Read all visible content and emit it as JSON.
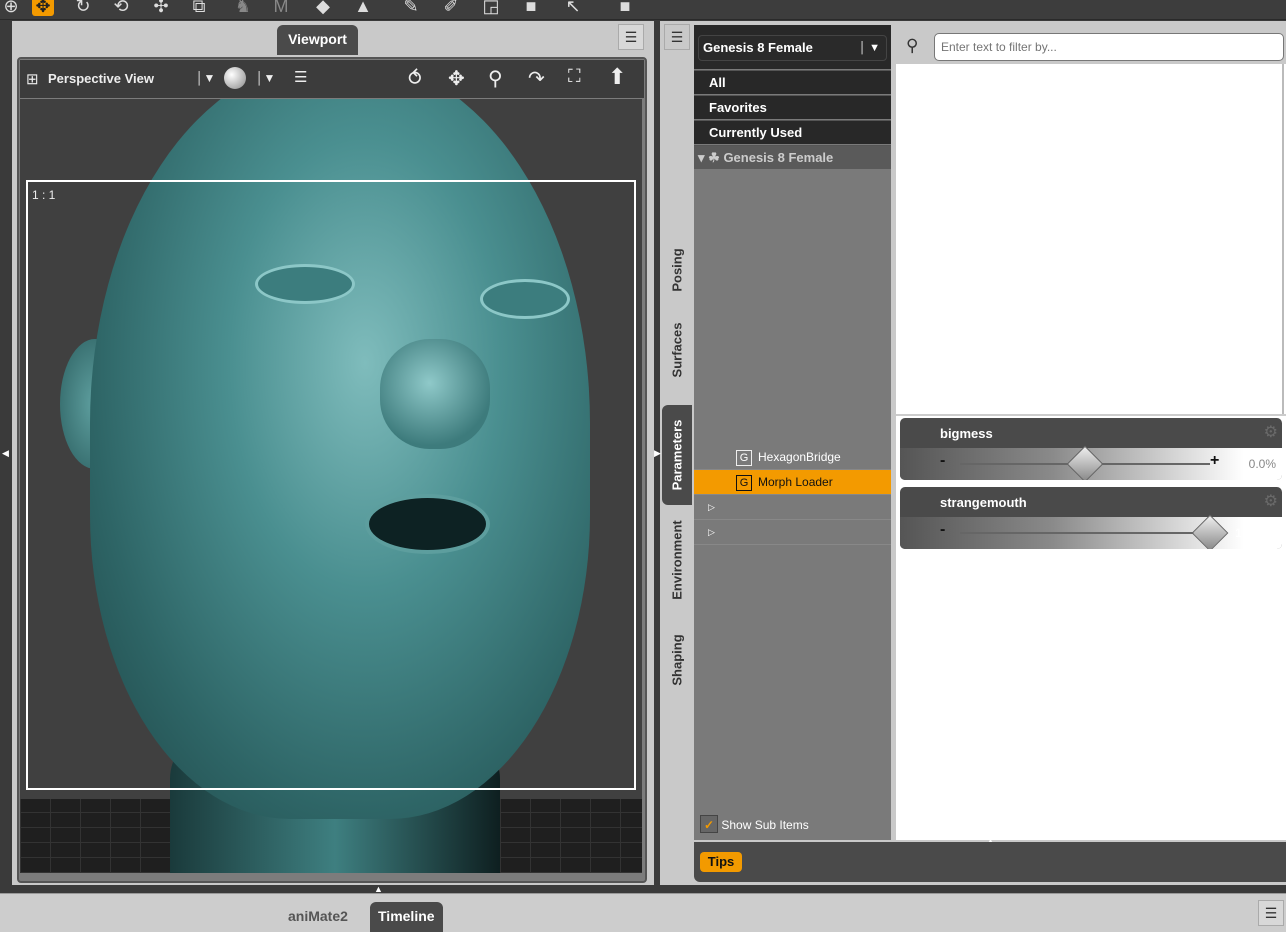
{
  "toolbar": {
    "icons": [
      "universal-tool-icon",
      "node-selection-icon",
      "rotate-icon",
      "twist-icon",
      "translate-icon",
      "scale-icon",
      "active-pose-icon",
      "joint-editor-icon",
      "geometry-editor-icon",
      "surface-selection-icon",
      "spot-render-icon",
      "pointer-icon",
      "render-icon"
    ]
  },
  "viewport": {
    "tab_label": "Viewport",
    "view_label": "Perspective View",
    "aspect_ratio": "1 : 1"
  },
  "parameters": {
    "figure_select": "Genesis 8 Female",
    "filter_placeholder": "Enter text to filter by...",
    "categories": [
      "All",
      "Favorites",
      "Currently Used"
    ],
    "tree_root": "Genesis 8 Female",
    "tree_items": [
      {
        "label": "HexagonBridge",
        "selected": false
      },
      {
        "label": "Morph Loader",
        "selected": true
      }
    ],
    "side_tabs": [
      "Posing",
      "Surfaces",
      "Parameters",
      "Environment",
      "Shaping"
    ],
    "active_tab": "Parameters",
    "show_sub_items": "Show Sub Items",
    "show_sub_items_checked": true,
    "sliders": [
      {
        "name": "bigmess",
        "value": "0.0%",
        "fraction": 0.5
      },
      {
        "name": "strangemouth",
        "value": "100.0%",
        "fraction": 1.0
      }
    ],
    "tips_label": "Tips"
  },
  "bottom": {
    "tabs": [
      "aniMate2",
      "Timeline"
    ],
    "active_tab": "Timeline"
  },
  "colors": {
    "accent": "#f39a00",
    "mesh": "#4a8f90"
  }
}
